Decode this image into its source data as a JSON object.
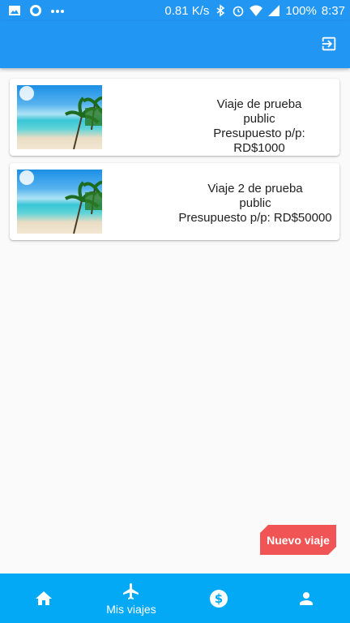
{
  "status_bar": {
    "speed": "0.81 K/s",
    "battery": "100%",
    "time": "8:37",
    "icons": [
      "image-icon",
      "messenger-icon",
      "more-dots-icon",
      "bluetooth-icon",
      "alarm-icon",
      "wifi-icon",
      "signal-icon",
      "battery-icon"
    ]
  },
  "app_bar": {
    "action_icon": "exit-to-app-icon"
  },
  "trips": [
    {
      "name": "Viaje de prueba",
      "visibility": "public",
      "budget": "Presupuesto p/p: RD$1000",
      "image": "beach-thumbnail"
    },
    {
      "name": "Viaje 2 de prueba",
      "visibility": "public",
      "budget": "Presupuesto p/p: RD$50000",
      "image": "beach-thumbnail"
    }
  ],
  "fab": {
    "label": "Nuevo viaje"
  },
  "bottom_nav": {
    "items": [
      {
        "icon": "home-icon",
        "label": ""
      },
      {
        "icon": "airplane-icon",
        "label": "Mis viajes"
      },
      {
        "icon": "dollar-icon",
        "label": ""
      },
      {
        "icon": "person-icon",
        "label": ""
      }
    ]
  },
  "colors": {
    "primary": "#2196f3",
    "bottom_nav": "#03a9f4",
    "fab": "#f05454",
    "background": "#fafafa"
  }
}
